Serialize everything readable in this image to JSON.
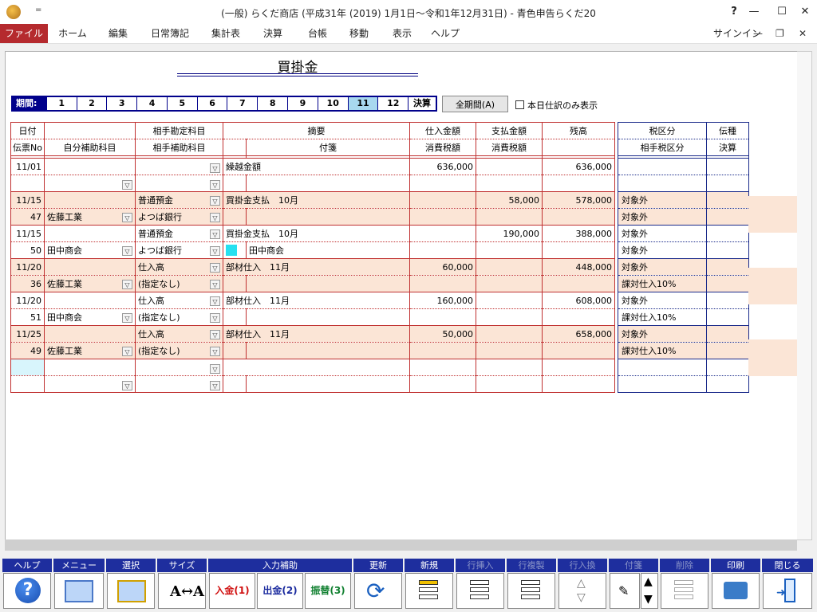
{
  "window": {
    "title": "(一般) らくだ商店 (平成31年 (2019) 1月1日〜令和1年12月31日) - 青色申告らくだ20",
    "quick_access": "=",
    "help": "?",
    "minimize": "—",
    "maximize": "☐",
    "close": "✕"
  },
  "menu": {
    "items": [
      "ファイル",
      "ホーム",
      "編集",
      "日常簿記",
      "集計表",
      "決算",
      "台帳",
      "移動",
      "表示",
      "ヘルプ"
    ],
    "signin": "サインイン",
    "doc_minimize": "—",
    "doc_restore": "❐",
    "doc_close": "✕"
  },
  "doc": {
    "title": "買掛金"
  },
  "period": {
    "label": "期間:",
    "months": [
      "1",
      "2",
      "3",
      "4",
      "5",
      "6",
      "7",
      "8",
      "9",
      "10",
      "11",
      "12"
    ],
    "selected": "11",
    "kessan": "決算",
    "all_button": "全期間(A)",
    "today_only": "本日仕訳のみ表示"
  },
  "headers": {
    "date": "日付",
    "slip_no": "伝票No",
    "own_sub": "自分補助科目",
    "counter_account": "相手勘定科目",
    "counter_sub": "相手補助科目",
    "summary": "摘要",
    "sticky": "付箋",
    "purchase": "仕入金額",
    "purchase_tax": "消費税額",
    "payment": "支払金額",
    "payment_tax": "消費税額",
    "balance": "残高",
    "tax_class": "税区分",
    "counter_tax": "相手税区分",
    "slip_type": "伝種",
    "kessan": "決算"
  },
  "rows": [
    {
      "date": "11/01",
      "no": "",
      "own_sub": "",
      "account": "",
      "counter_sub": "",
      "summary": "繰越金額",
      "purchase": "636,000",
      "payment": "",
      "balance": "636,000",
      "tax1": "",
      "tax2": "",
      "sticky": ""
    },
    {
      "date": "11/15",
      "no": "47",
      "own_sub": "佐藤工業",
      "account": "普通預金",
      "counter_sub": "よつば銀行",
      "summary": "買掛金支払　10月",
      "purchase": "",
      "payment": "58,000",
      "balance": "578,000",
      "tax1": "対象外",
      "tax2": "対象外",
      "sticky": ""
    },
    {
      "date": "11/15",
      "no": "50",
      "own_sub": "田中商会",
      "account": "普通預金",
      "counter_sub": "よつば銀行",
      "summary": "買掛金支払　10月",
      "purchase": "",
      "payment": "190,000",
      "balance": "388,000",
      "tax1": "対象外",
      "tax2": "対象外",
      "sticky": "田中商会"
    },
    {
      "date": "11/20",
      "no": "36",
      "own_sub": "佐藤工業",
      "account": "仕入高",
      "counter_sub": "(指定なし)",
      "summary": "部材仕入　11月",
      "purchase": "60,000",
      "payment": "",
      "balance": "448,000",
      "tax1": "対象外",
      "tax2": "課対仕入10%",
      "sticky": ""
    },
    {
      "date": "11/20",
      "no": "51",
      "own_sub": "田中商会",
      "account": "仕入高",
      "counter_sub": "(指定なし)",
      "summary": "部材仕入　11月",
      "purchase": "160,000",
      "payment": "",
      "balance": "608,000",
      "tax1": "対象外",
      "tax2": "課対仕入10%",
      "sticky": ""
    },
    {
      "date": "11/25",
      "no": "49",
      "own_sub": "佐藤工業",
      "account": "仕入高",
      "counter_sub": "(指定なし)",
      "summary": "部材仕入　11月",
      "purchase": "50,000",
      "payment": "",
      "balance": "658,000",
      "tax1": "対象外",
      "tax2": "課対仕入10%",
      "sticky": ""
    }
  ],
  "toolbar": {
    "help": "ヘルプ",
    "menu": "メニュー",
    "select": "選択",
    "size": "サイズ",
    "input_assist": "入力補助",
    "deposit": "入金(1)",
    "withdraw": "出金(2)",
    "transfer": "振替(3)",
    "update": "更新",
    "new": "新規",
    "insert_row": "行挿入",
    "copy_row": "行複製",
    "swap_row": "行入換",
    "sticky": "付箋",
    "delete": "削除",
    "print": "印刷",
    "close": "閉じる"
  },
  "colors": {
    "accent": "#b52a2e",
    "toolbar": "#1e2e9e",
    "row_alt": "#fbe5d6",
    "ledger_border": "#c03030",
    "tax_border": "#1a2a8a"
  }
}
